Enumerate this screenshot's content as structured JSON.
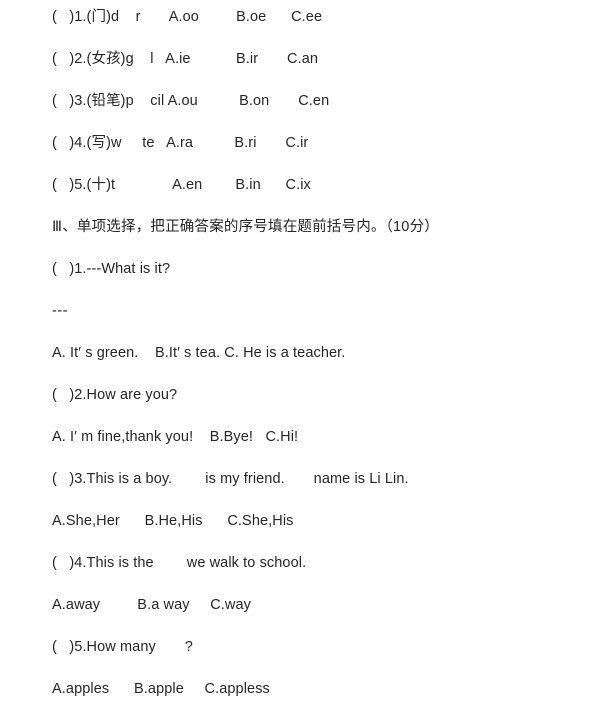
{
  "document": {
    "page_background": "#ffffff",
    "text_color": "#262626",
    "gutter_color": "#cfcfcf",
    "lines": [
      {
        "id": "phonics-q1",
        "kind": "question",
        "text": "(   )1.(门)d    r       A.oo         B.oe      C.ee"
      },
      {
        "id": "phonics-q2",
        "kind": "question",
        "text": "(   )2.(女孩)g    l   A.ie           B.ir       C.an"
      },
      {
        "id": "phonics-q3",
        "kind": "question",
        "text": "(   )3.(铅笔)p    cil A.ou          B.on       C.en"
      },
      {
        "id": "phonics-q4",
        "kind": "question",
        "text": "(   )4.(写)w     te   A.ra          B.ri       C.ir"
      },
      {
        "id": "phonics-q5",
        "kind": "question",
        "text": "(   )5.(十)t              A.en        B.in      C.ix"
      },
      {
        "id": "section-heading-3",
        "kind": "heading",
        "text": "Ⅲ、单项选择，把正确答案的序号填在题前括号内。（10分）"
      },
      {
        "id": "choice-q1",
        "kind": "question",
        "text": "(   )1.---What is it?"
      },
      {
        "id": "choice-q1-dash",
        "kind": "dash",
        "text": "---"
      },
      {
        "id": "choice-q1-options",
        "kind": "options",
        "text": "A. It′ s green.    B.It′ s tea. C. He is a teacher."
      },
      {
        "id": "choice-q2",
        "kind": "question",
        "text": "(   )2.How are you?"
      },
      {
        "id": "choice-q2-options",
        "kind": "options",
        "text": "A. I′ m fine,thank you!    B.Bye!   C.Hi!"
      },
      {
        "id": "choice-q3",
        "kind": "question",
        "text": "(   )3.This is a boy.        is my friend.       name is Li Lin."
      },
      {
        "id": "choice-q3-options",
        "kind": "options",
        "text": "A.She,Her      B.He,His      C.She,His"
      },
      {
        "id": "choice-q4",
        "kind": "question",
        "text": "(   )4.This is the        we walk to school."
      },
      {
        "id": "choice-q4-options",
        "kind": "options",
        "text": "A.away         B.a way     C.way"
      },
      {
        "id": "choice-q5",
        "kind": "question",
        "text": "(   )5.How many       ?"
      },
      {
        "id": "choice-q5-options",
        "kind": "options",
        "text": "A.apples      B.apple     C.appless"
      }
    ]
  }
}
